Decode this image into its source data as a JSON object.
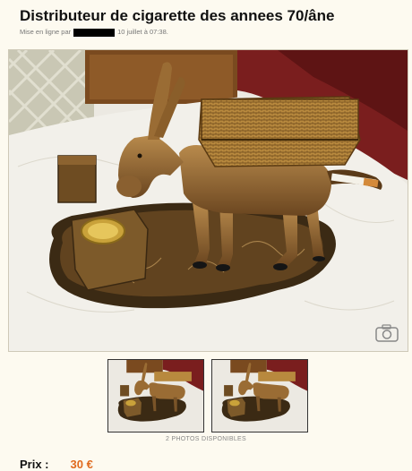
{
  "ad": {
    "title": "Distributeur de cigarette des annees 70/âne",
    "meta_prefix": "Mise en ligne par",
    "meta_date": "10 juillet à 07:38."
  },
  "gallery": {
    "main_photo_icon": "camera-icon",
    "thumbnails": [
      "photo-1",
      "photo-2"
    ],
    "count_label": "2 PHOTOS DISPONIBLES"
  },
  "price": {
    "label": "Prix :",
    "value": "30 €"
  },
  "colors": {
    "price": "#e06a1e",
    "background": "#fdfaf0"
  }
}
